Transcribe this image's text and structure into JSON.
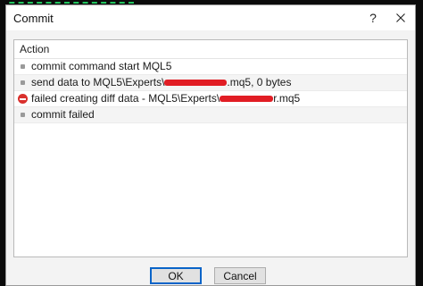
{
  "dialog": {
    "title": "Commit",
    "help_label": "?",
    "list_header": "Action",
    "rows": [
      {
        "type": "info",
        "text": "commit command start MQL5"
      },
      {
        "type": "info",
        "text_before": "send data to MQL5\\Experts\\",
        "text_after": ".mq5, 0 bytes"
      },
      {
        "type": "error",
        "text_before": "failed creating diff data - MQL5\\Experts\\",
        "text_after": "r.mq5"
      },
      {
        "type": "info",
        "text": "commit failed"
      }
    ],
    "ok_label": "OK",
    "cancel_label": "Cancel"
  },
  "colors": {
    "error": "#d9302c",
    "redaction": "#e11d24",
    "background_dash": "#22c55e"
  },
  "icons": {
    "close": "close-icon",
    "error": "error-icon",
    "bullet": "bullet-icon"
  }
}
